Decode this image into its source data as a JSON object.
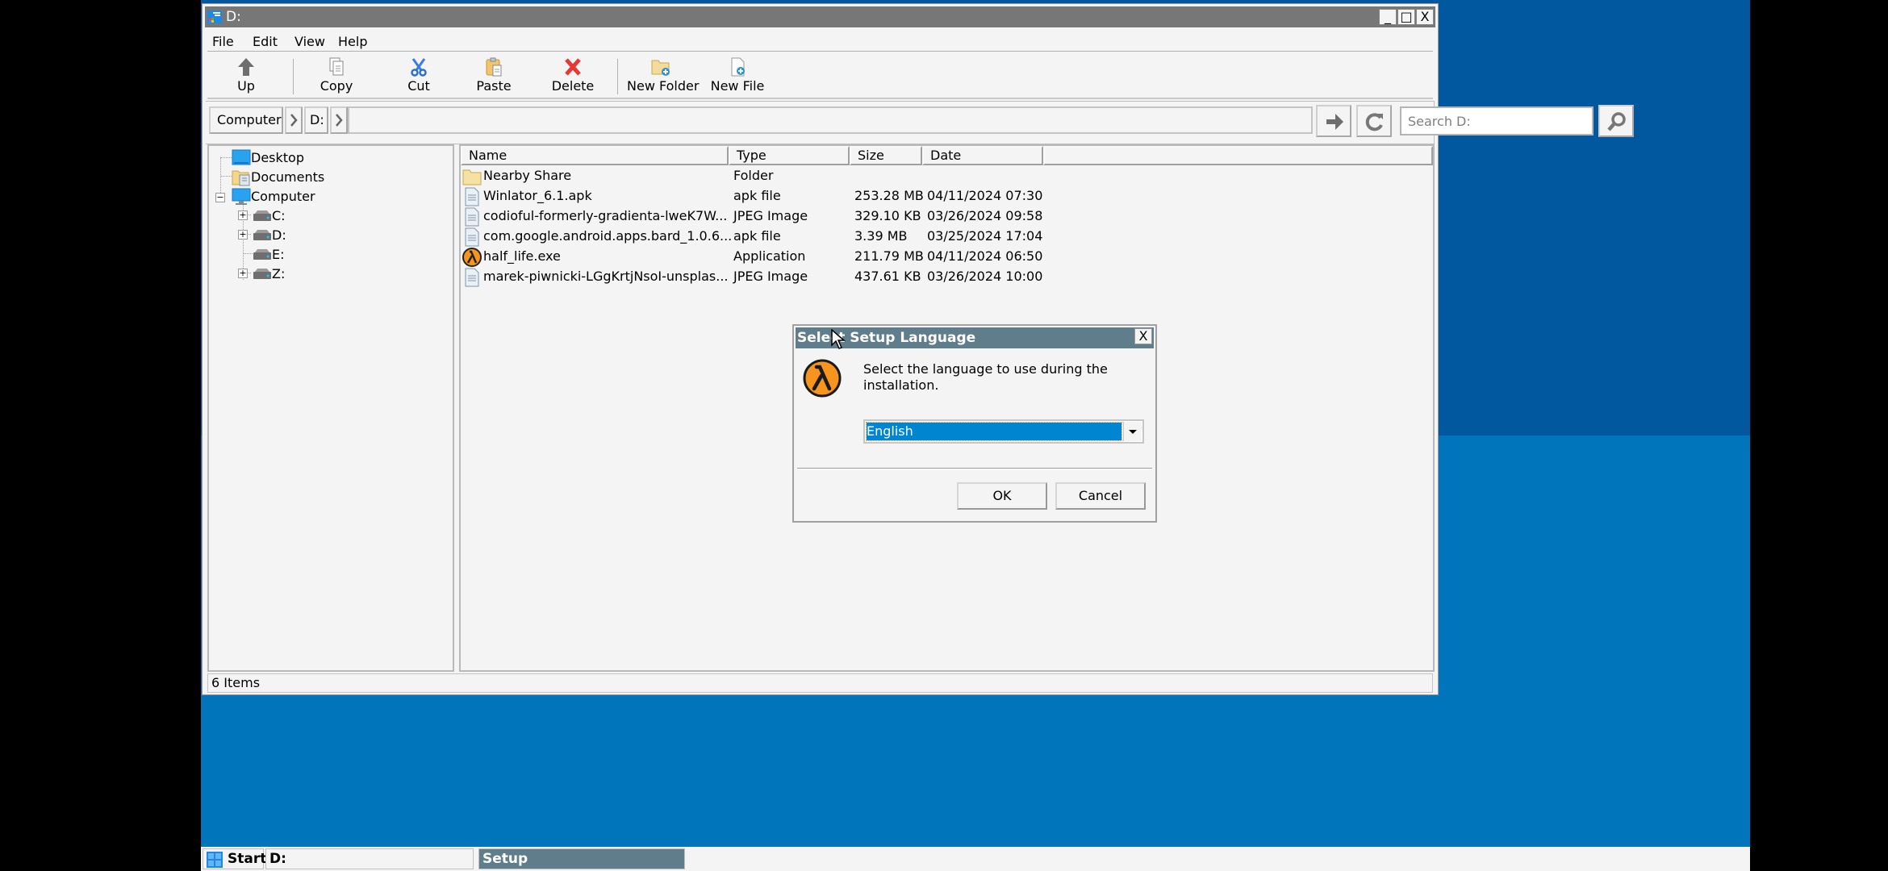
{
  "window": {
    "title": "D:",
    "controls": {
      "minimize": "_",
      "maximize": "□",
      "close": "X"
    }
  },
  "menu": [
    "File",
    "Edit",
    "View",
    "Help"
  ],
  "toolbar": {
    "up": "Up",
    "copy": "Copy",
    "cut": "Cut",
    "paste": "Paste",
    "delete": "Delete",
    "new_folder": "New Folder",
    "new_file": "New File"
  },
  "address": {
    "breadcrumb": [
      "Computer",
      "D:"
    ],
    "search_placeholder": "Search D:"
  },
  "tree": {
    "desktop": "Desktop",
    "documents": "Documents",
    "computer": "Computer",
    "drives": [
      "C:",
      "D:",
      "E:",
      "Z:"
    ]
  },
  "list": {
    "columns": {
      "name": "Name",
      "type": "Type",
      "size": "Size",
      "date": "Date"
    },
    "rows": [
      {
        "name": "Nearby Share",
        "type": "Folder",
        "size": "",
        "date": "",
        "icon": "folder"
      },
      {
        "name": "Winlator_6.1.apk",
        "type": "apk file",
        "size": "253.28 MB",
        "date": "04/11/2024 07:30",
        "icon": "file"
      },
      {
        "name": "codioful-formerly-gradienta-lweK7W...",
        "type": "JPEG Image",
        "size": "329.10 KB",
        "date": "03/26/2024 09:58",
        "icon": "file"
      },
      {
        "name": "com.google.android.apps.bard_1.0.6...",
        "type": "apk file",
        "size": "3.39 MB",
        "date": "03/25/2024 17:04",
        "icon": "file"
      },
      {
        "name": "half_life.exe",
        "type": "Application",
        "size": "211.79 MB",
        "date": "04/11/2024 06:50",
        "icon": "half-life"
      },
      {
        "name": "marek-piwnicki-LGgKrtjNsoI-unsplas...",
        "type": "JPEG Image",
        "size": "437.61 KB",
        "date": "03/26/2024 10:00",
        "icon": "file"
      }
    ]
  },
  "status": {
    "text": "6 Items"
  },
  "dialog": {
    "title": "Select Setup Language",
    "close": "X",
    "message": "Select the language to use during the installation.",
    "language_selected": "English",
    "ok": "OK",
    "cancel": "Cancel"
  },
  "taskbar": {
    "start": "Start",
    "tasks": [
      {
        "label": "D:",
        "active": false
      },
      {
        "label": "Setup",
        "active": true
      }
    ]
  },
  "colors": {
    "desktop_top": "#01589f",
    "desktop_bottom": "#0075bb",
    "titlebar": "#777777",
    "dialog_titlebar": "#607d8b",
    "selection": "#0086d1",
    "half_life_orange": "#f7941d"
  }
}
